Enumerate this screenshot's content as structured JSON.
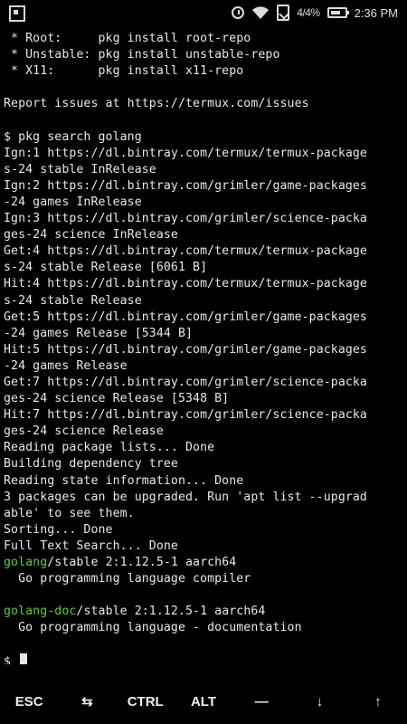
{
  "status_bar": {
    "left_icon": "square-app-icon",
    "alarm_icon": "alarm-clock-icon",
    "wifi_icon": "wifi-icon",
    "data_icon": "mobile-data-icon",
    "signal_text": "4/4%",
    "battery_icon": "battery-icon",
    "battery_level": 0.7,
    "time": "2:36 PM"
  },
  "terminal": {
    "lines": [
      [
        {
          "t": " * Root:     pkg install root-repo"
        }
      ],
      [
        {
          "t": " * Unstable: pkg install unstable-repo"
        }
      ],
      [
        {
          "t": " * X11:      pkg install x11-repo"
        }
      ],
      [
        {
          "t": ""
        }
      ],
      [
        {
          "t": "Report issues at https://termux.com/issues"
        }
      ],
      [
        {
          "t": ""
        }
      ],
      [
        {
          "t": "$ pkg search golang"
        }
      ],
      [
        {
          "t": "Ign:1 https://dl.bintray.com/termux/termux-package"
        }
      ],
      [
        {
          "t": "s-24 stable InRelease"
        }
      ],
      [
        {
          "t": "Ign:2 https://dl.bintray.com/grimler/game-packages"
        }
      ],
      [
        {
          "t": "-24 games InRelease"
        }
      ],
      [
        {
          "t": "Ign:3 https://dl.bintray.com/grimler/science-packa"
        }
      ],
      [
        {
          "t": "ges-24 science InRelease"
        }
      ],
      [
        {
          "t": "Get:4 https://dl.bintray.com/termux/termux-package"
        }
      ],
      [
        {
          "t": "s-24 stable Release [6061 B]"
        }
      ],
      [
        {
          "t": "Hit:4 https://dl.bintray.com/termux/termux-package"
        }
      ],
      [
        {
          "t": "s-24 stable Release"
        }
      ],
      [
        {
          "t": "Get:5 https://dl.bintray.com/grimler/game-packages"
        }
      ],
      [
        {
          "t": "-24 games Release [5344 B]"
        }
      ],
      [
        {
          "t": "Hit:5 https://dl.bintray.com/grimler/game-packages"
        }
      ],
      [
        {
          "t": "-24 games Release"
        }
      ],
      [
        {
          "t": "Get:7 https://dl.bintray.com/grimler/science-packa"
        }
      ],
      [
        {
          "t": "ges-24 science Release [5348 B]"
        }
      ],
      [
        {
          "t": "Hit:7 https://dl.bintray.com/grimler/science-packa"
        }
      ],
      [
        {
          "t": "ges-24 science Release"
        }
      ],
      [
        {
          "t": "Reading package lists... Done"
        }
      ],
      [
        {
          "t": "Building dependency tree"
        }
      ],
      [
        {
          "t": "Reading state information... Done"
        }
      ],
      [
        {
          "t": "3 packages can be upgraded. Run 'apt list --upgrad"
        }
      ],
      [
        {
          "t": "able' to see them."
        }
      ],
      [
        {
          "t": "Sorting... Done"
        }
      ],
      [
        {
          "t": "Full Text Search... Done"
        }
      ],
      [
        {
          "t": "golang",
          "hl": true
        },
        {
          "t": "/stable 2:1.12.5-1 aarch64"
        }
      ],
      [
        {
          "t": "  Go programming language compiler"
        }
      ],
      [
        {
          "t": ""
        }
      ],
      [
        {
          "t": "golang-doc",
          "hl": true
        },
        {
          "t": "/stable 2:1.12.5-1 aarch64"
        }
      ],
      [
        {
          "t": "  Go programming language - documentation"
        }
      ],
      [
        {
          "t": ""
        }
      ]
    ],
    "prompt": "$ "
  },
  "extra_keys": [
    {
      "label": "ESC",
      "name": "esc-key"
    },
    {
      "label": "⇆",
      "name": "tab-key"
    },
    {
      "label": "CTRL",
      "name": "ctrl-key"
    },
    {
      "label": "ALT",
      "name": "alt-key"
    },
    {
      "label": "—",
      "name": "dash-key"
    },
    {
      "label": "↓",
      "name": "down-arrow-key"
    },
    {
      "label": "↑",
      "name": "up-arrow-key"
    }
  ]
}
